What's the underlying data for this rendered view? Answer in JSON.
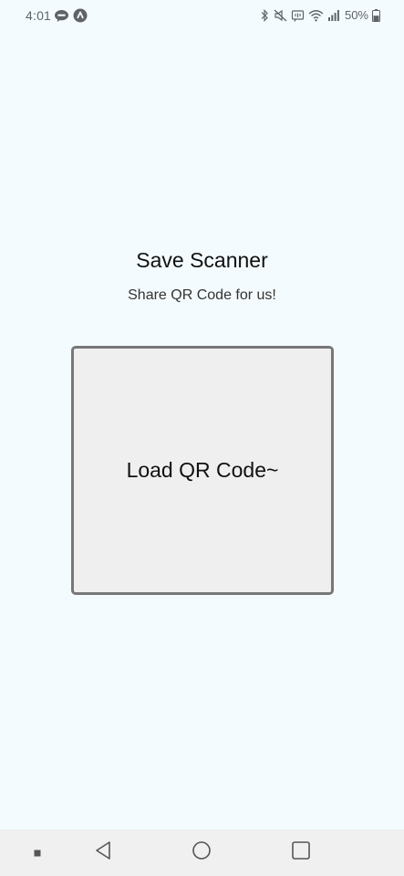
{
  "status_bar": {
    "time": "4:01",
    "battery": "50%",
    "left_icons": [
      "talk-icon",
      "assistant-icon"
    ],
    "right_icons": [
      "bluetooth-icon",
      "mute-icon",
      "nfc-icon",
      "wifi-icon",
      "signal-icon",
      "battery-icon"
    ]
  },
  "main": {
    "title": "Save Scanner",
    "subtitle": "Share QR Code for us!",
    "load_button_label": "Load QR Code~"
  },
  "nav_bar": {
    "buttons": [
      "recent-dot-icon",
      "back-icon",
      "home-icon",
      "overview-icon"
    ]
  },
  "colors": {
    "background": "#f4fbfe",
    "box_fill": "#efefef",
    "box_border": "#777777",
    "nav_bar": "#f0f0f0"
  }
}
